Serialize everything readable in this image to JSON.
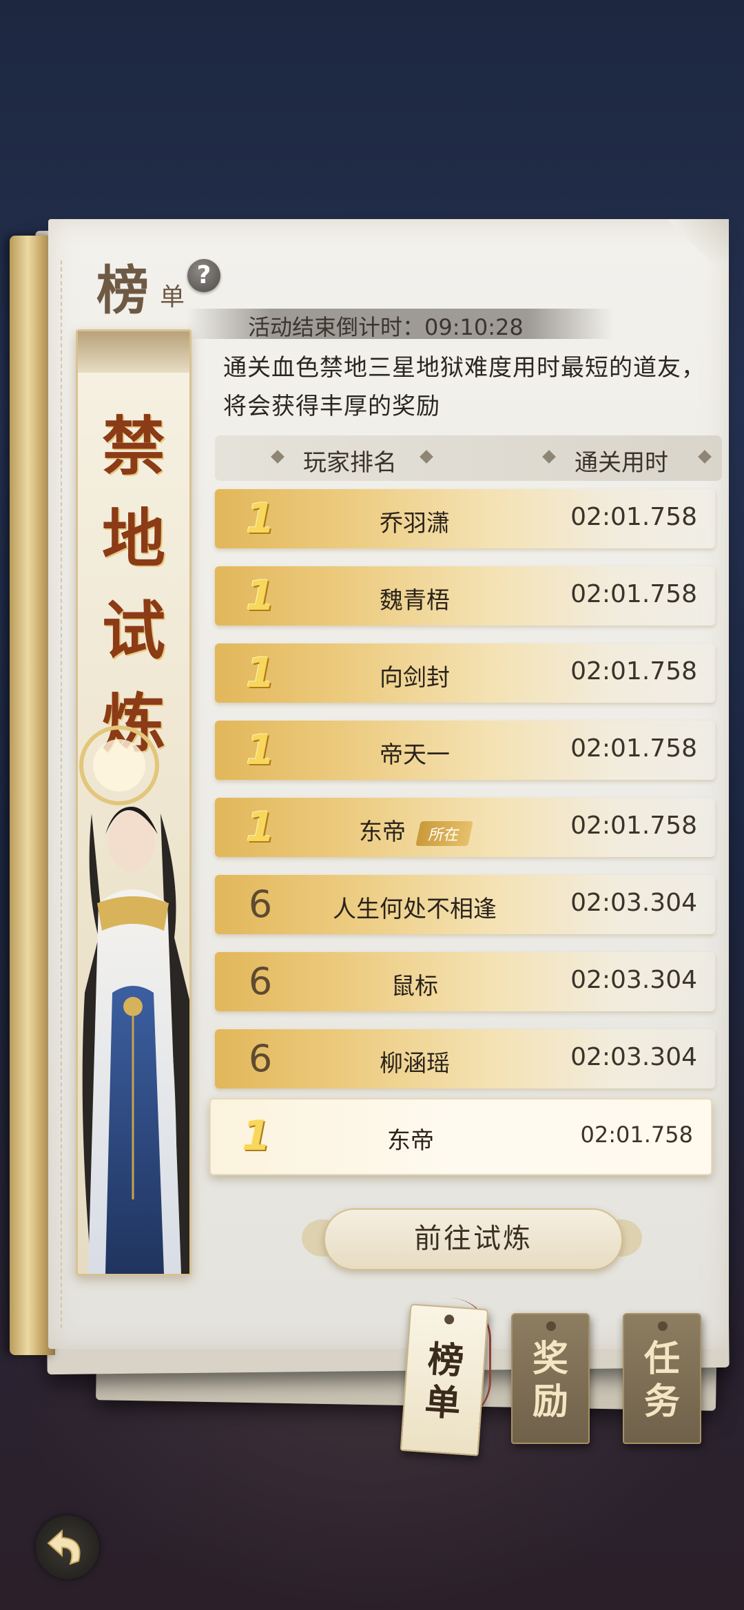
{
  "panel": {
    "title_big": "榜",
    "title_small": "单",
    "help_icon": "?",
    "countdown": "活动结束倒计时：09:10:28",
    "description": "通关血色禁地三星地狱难度用时最短的道友，将会获得丰厚的奖励"
  },
  "banner": {
    "title": "禁地试炼"
  },
  "table": {
    "col_player": "玩家排名",
    "col_time": "通关用时",
    "rows": [
      {
        "rank": "1",
        "name": "乔羽潇",
        "time": "02:01.758",
        "gold": true
      },
      {
        "rank": "1",
        "name": "魏青梧",
        "time": "02:01.758",
        "gold": true
      },
      {
        "rank": "1",
        "name": "向剑封",
        "time": "02:01.758",
        "gold": true
      },
      {
        "rank": "1",
        "name": "帝天一",
        "time": "02:01.758",
        "gold": true
      },
      {
        "rank": "1",
        "name": "东帝",
        "time": "02:01.758",
        "gold": true,
        "badge": "所在"
      },
      {
        "rank": "6",
        "name": "人生何处不相逢",
        "time": "02:03.304",
        "gold": false
      },
      {
        "rank": "6",
        "name": "鼠标",
        "time": "02:03.304",
        "gold": false
      },
      {
        "rank": "6",
        "name": "柳涵瑶",
        "time": "02:03.304",
        "gold": false
      }
    ],
    "mine": {
      "rank": "1",
      "name": "东帝",
      "time": "02:01.758"
    }
  },
  "go_button": "前往试炼",
  "tabs": [
    {
      "label": "榜单",
      "active": true
    },
    {
      "label": "奖励",
      "active": false
    },
    {
      "label": "任务",
      "active": false
    }
  ],
  "icons": {
    "back": "back-arrow-icon",
    "help": "question-icon"
  },
  "colors": {
    "gold_row": "#ecca7d",
    "banner_title": "#8b3b16",
    "background": "#1d2740"
  }
}
